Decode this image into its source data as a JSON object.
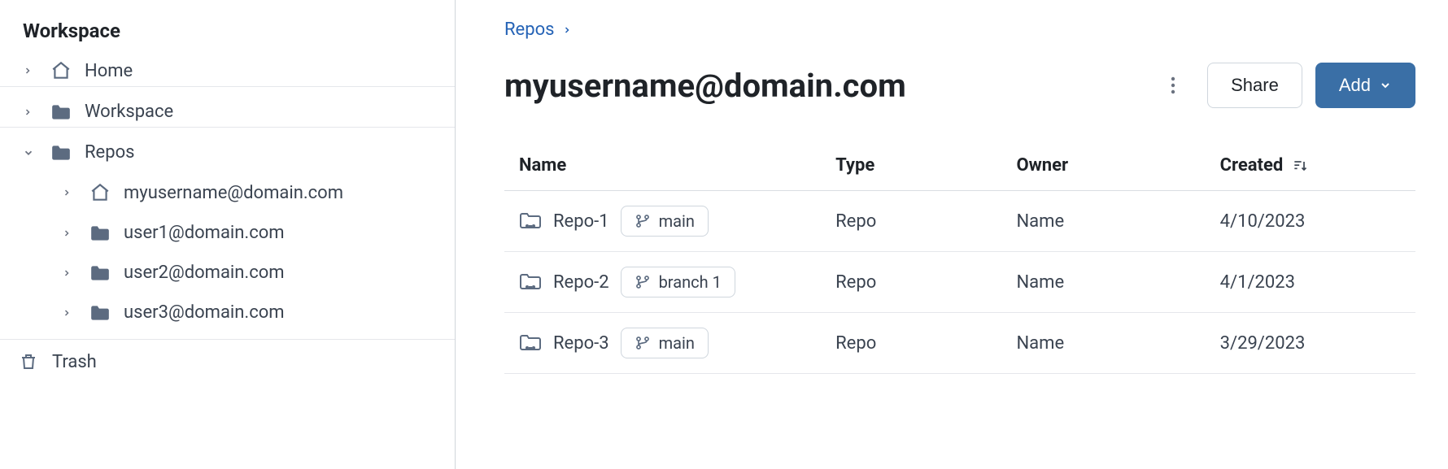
{
  "sidebar": {
    "title": "Workspace",
    "home_label": "Home",
    "workspace_label": "Workspace",
    "repos_label": "Repos",
    "users": [
      {
        "label": "myusername@domain.com",
        "icon": "home"
      },
      {
        "label": "user1@domain.com",
        "icon": "folder"
      },
      {
        "label": "user2@domain.com",
        "icon": "folder"
      },
      {
        "label": "user3@domain.com",
        "icon": "folder"
      }
    ],
    "trash_label": "Trash"
  },
  "breadcrumb": {
    "parent": "Repos"
  },
  "page": {
    "title": "myusername@domain.com",
    "share_label": "Share",
    "add_label": "Add"
  },
  "table": {
    "columns": {
      "name": "Name",
      "type": "Type",
      "owner": "Owner",
      "created": "Created"
    },
    "rows": [
      {
        "name": "Repo-1",
        "branch": "main",
        "type": "Repo",
        "owner": "Name",
        "created": "4/10/2023"
      },
      {
        "name": "Repo-2",
        "branch": "branch 1",
        "type": "Repo",
        "owner": "Name",
        "created": "4/1/2023"
      },
      {
        "name": "Repo-3",
        "branch": "main",
        "type": "Repo",
        "owner": "Name",
        "created": "3/29/2023"
      }
    ]
  }
}
